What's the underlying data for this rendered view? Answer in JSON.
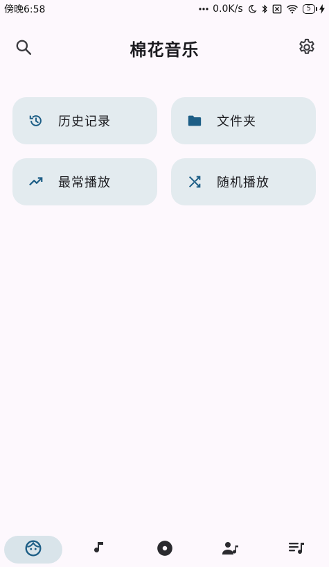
{
  "status_bar": {
    "time": "傍晚6:58",
    "network_speed": "0.0K/s",
    "battery_level": "5",
    "icons": [
      "more-dots-icon",
      "moon-icon",
      "bluetooth-icon",
      "sim-x-icon",
      "wifi-icon",
      "battery-icon",
      "charging-icon"
    ]
  },
  "app_bar": {
    "title": "棉花音乐",
    "search_icon": "search-icon",
    "settings_icon": "gear-icon"
  },
  "tiles": [
    {
      "label": "历史记录",
      "icon": "history-icon"
    },
    {
      "label": "文件夹",
      "icon": "folder-icon"
    },
    {
      "label": "最常播放",
      "icon": "trending-up-icon"
    },
    {
      "label": "随机播放",
      "icon": "shuffle-icon"
    }
  ],
  "bottom_nav": {
    "items": [
      {
        "icon": "face-icon",
        "active": true
      },
      {
        "icon": "music-note-icon",
        "active": false
      },
      {
        "icon": "album-icon",
        "active": false
      },
      {
        "icon": "artist-icon",
        "active": false
      },
      {
        "icon": "playlist-icon",
        "active": false
      }
    ]
  },
  "colors": {
    "accent": "#1d5e86",
    "tile_background": "#e3ebef",
    "page_background": "#fdf8fd",
    "nav_active_background": "#d9e4ea"
  }
}
